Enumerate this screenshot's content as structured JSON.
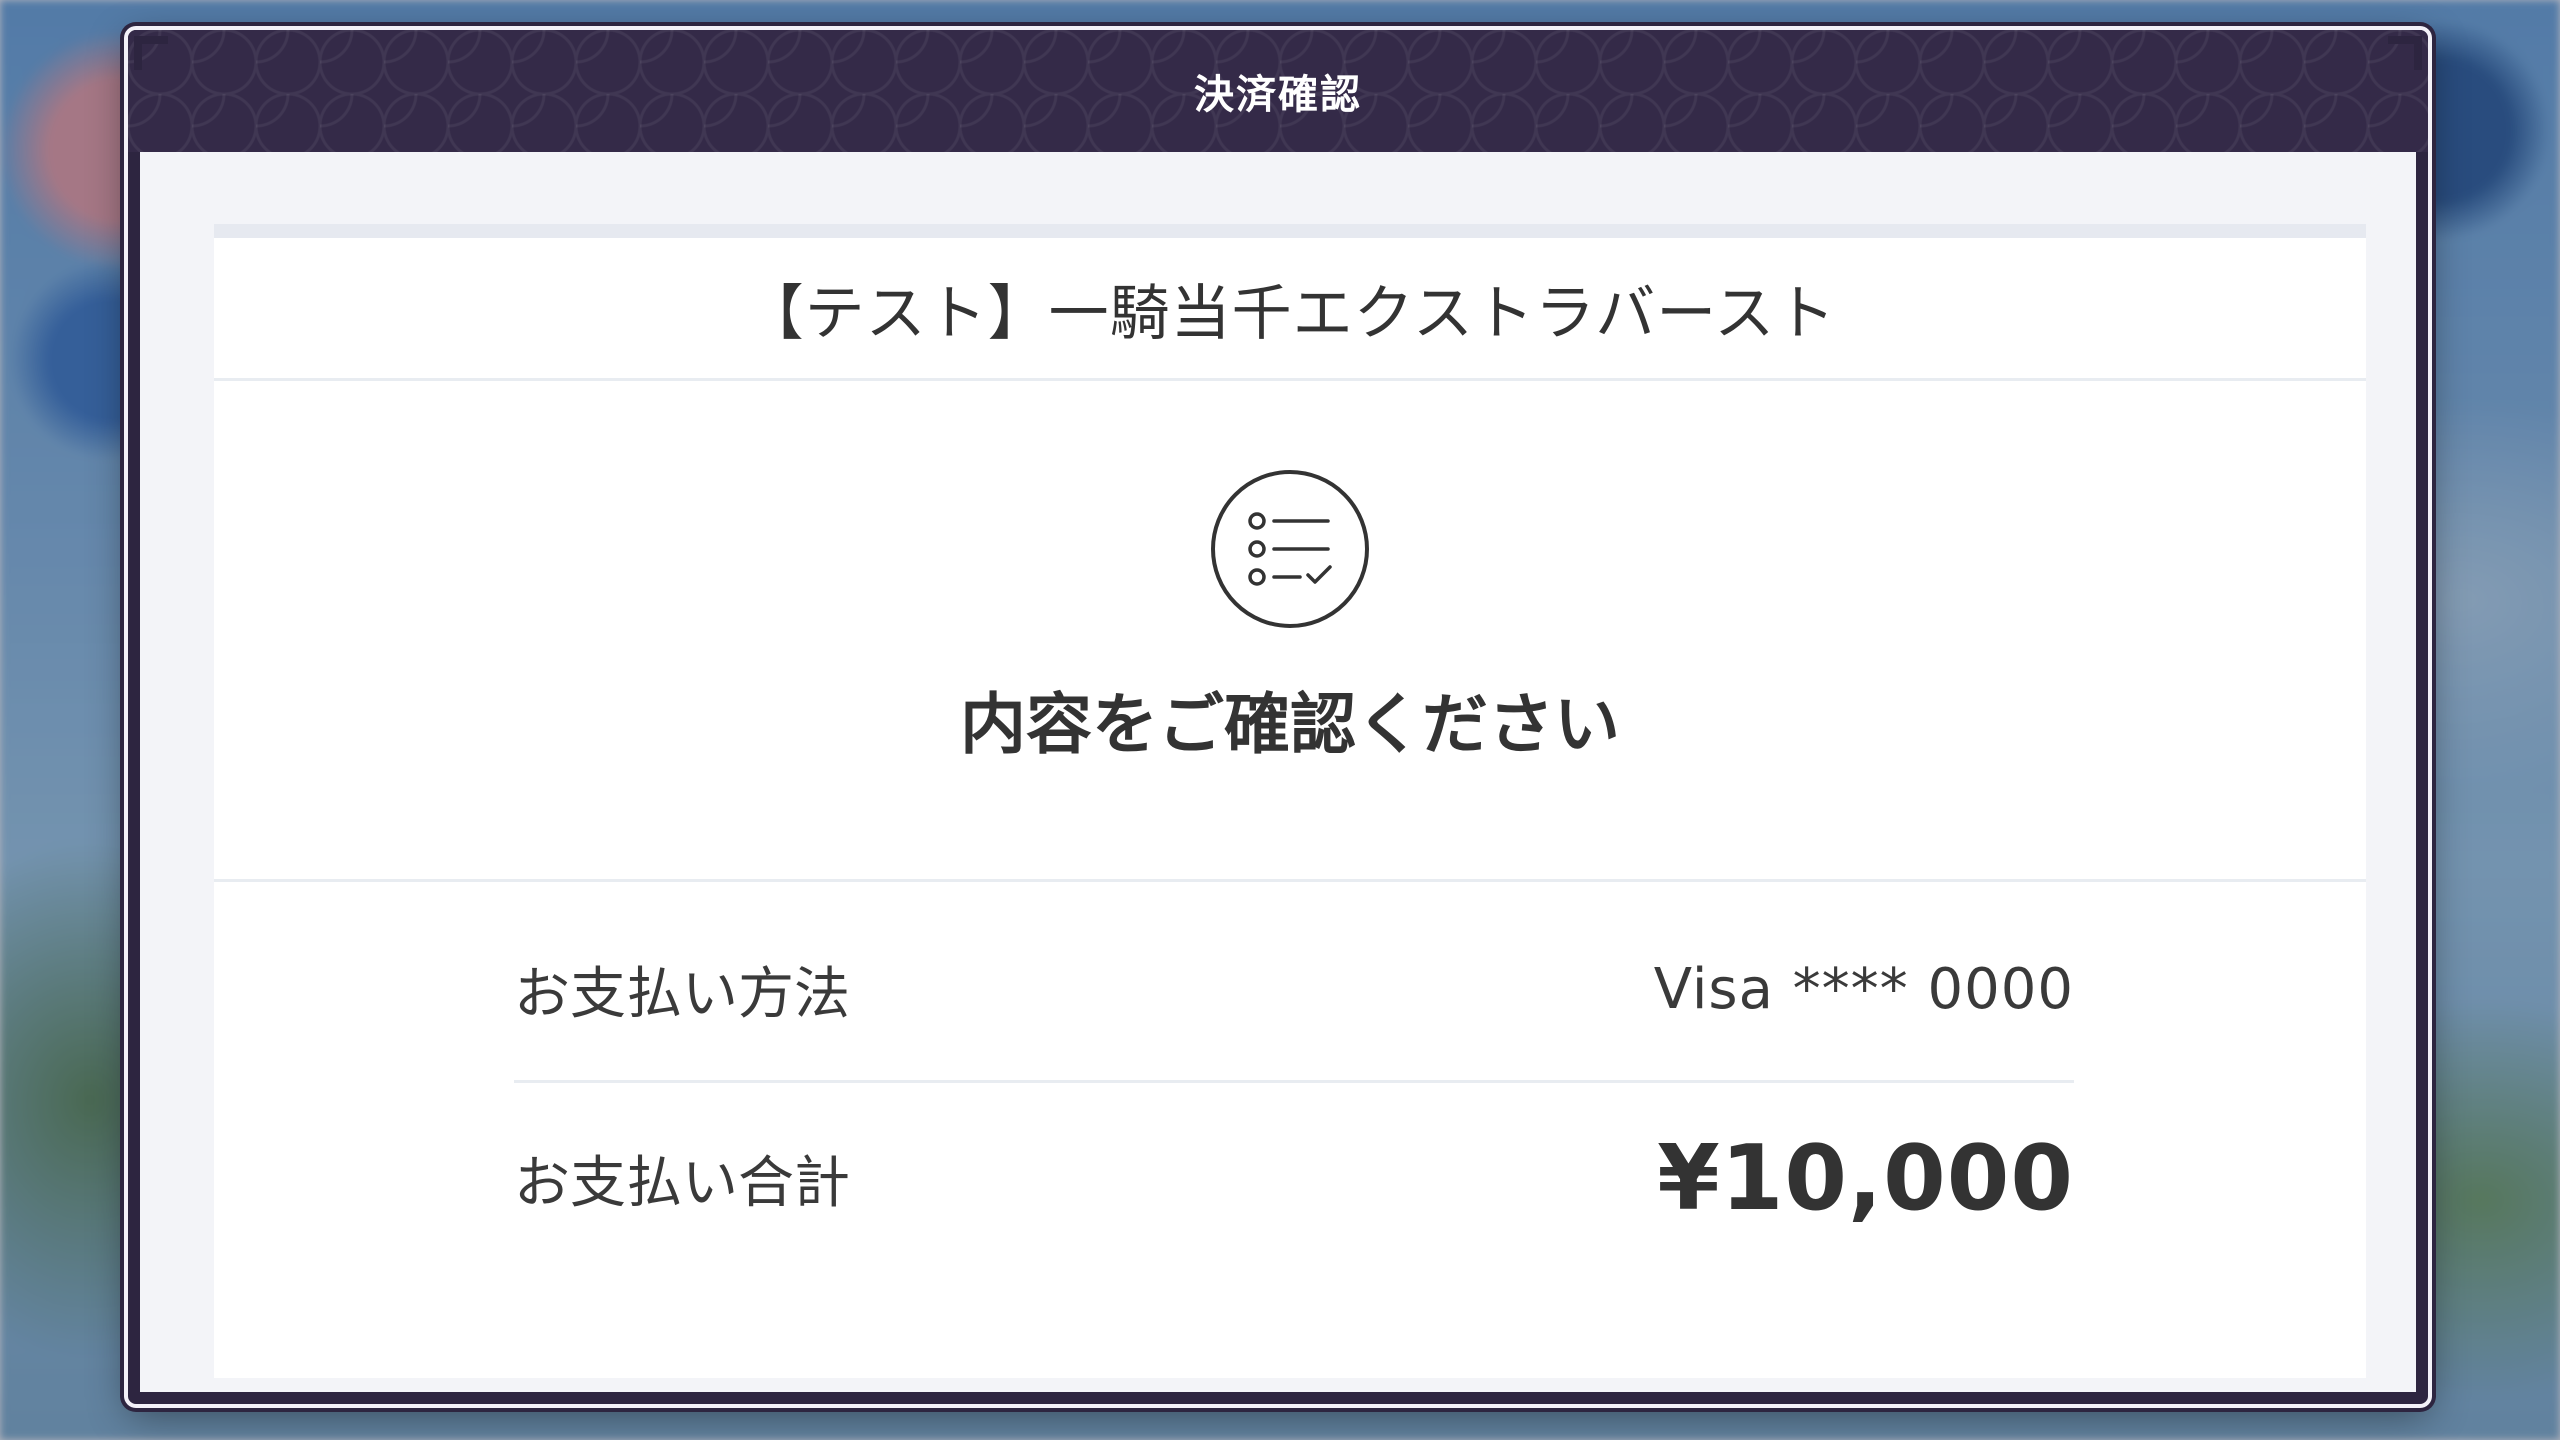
{
  "dialog": {
    "title": "決済確認"
  },
  "product": {
    "name": "【テスト】一騎当千エクストラバースト"
  },
  "confirm": {
    "icon": "checklist-icon",
    "message": "内容をご確認ください"
  },
  "payment": {
    "method_label": "お支払い方法",
    "method_value": "Visa **** 0000",
    "total_label": "お支払い合計",
    "total_value": "¥10,000"
  },
  "colors": {
    "header_bg": "#342a48",
    "frame": "#2d2540",
    "text": "#333333",
    "divider": "#e8ecf1"
  }
}
